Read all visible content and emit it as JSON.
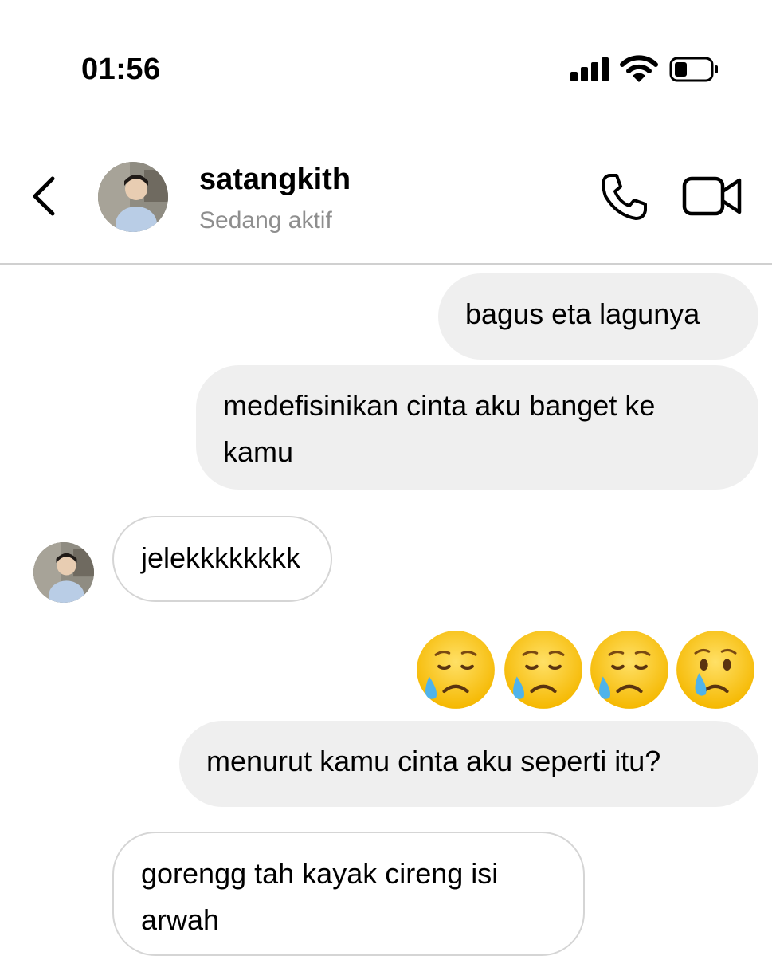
{
  "status_bar": {
    "time": "01:56",
    "battery_level": 0.35
  },
  "header": {
    "username": "satangkith",
    "status": "Sedang aktif",
    "icons": {
      "back": "chevron-left-icon",
      "call": "phone-icon",
      "video": "video-camera-icon"
    }
  },
  "messages": [
    {
      "side": "sent",
      "text": "bagus eta lagunya"
    },
    {
      "side": "sent",
      "text": "medefisinikan cinta aku banget ke kamu"
    },
    {
      "side": "received",
      "text": "jelekkkkkkkk"
    },
    {
      "side": "sent",
      "type": "emoji",
      "emoji": [
        "😥",
        "😥",
        "😥",
        "😢"
      ]
    },
    {
      "side": "sent",
      "text": "menurut kamu cinta aku seperti itu?"
    },
    {
      "side": "received",
      "text": "gorengg tah kayak cireng isi arwah"
    }
  ],
  "colors": {
    "sent_bubble": "#efefef",
    "received_border": "#d5d5d5",
    "secondary_text": "#8e8e8e"
  }
}
